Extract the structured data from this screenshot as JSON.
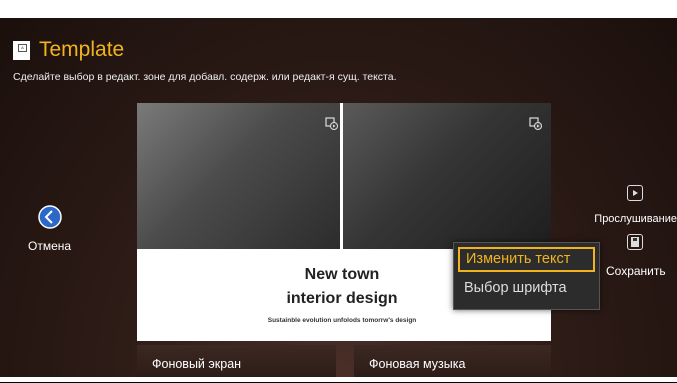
{
  "header": {
    "title": "Template",
    "hint": "Сделайте выбор в редакт. зоне для добавл. содерж. или редакт-я сущ. текста."
  },
  "preview": {
    "heading_line1": "New town",
    "heading_line2": "interior design",
    "subtext": "Sustainble evolution unfolods tomorrw's design"
  },
  "context_menu": {
    "items": [
      "Изменить текст",
      "Выбор шрифта"
    ],
    "selected": "Изменить текст"
  },
  "left_nav": {
    "cancel_label": "Отмена"
  },
  "right_nav": {
    "preview_label": "Прослушивание",
    "save_label": "Сохранить"
  },
  "bottom": {
    "background_screen": "Фоновый экран",
    "background_music": "Фоновая музыка"
  },
  "colors": {
    "accent": "#f2b41e",
    "background": "#2e1c17"
  },
  "icons": [
    "template-icon",
    "back-arrow-icon",
    "media-play-icon",
    "preview-icon",
    "save-icon"
  ]
}
